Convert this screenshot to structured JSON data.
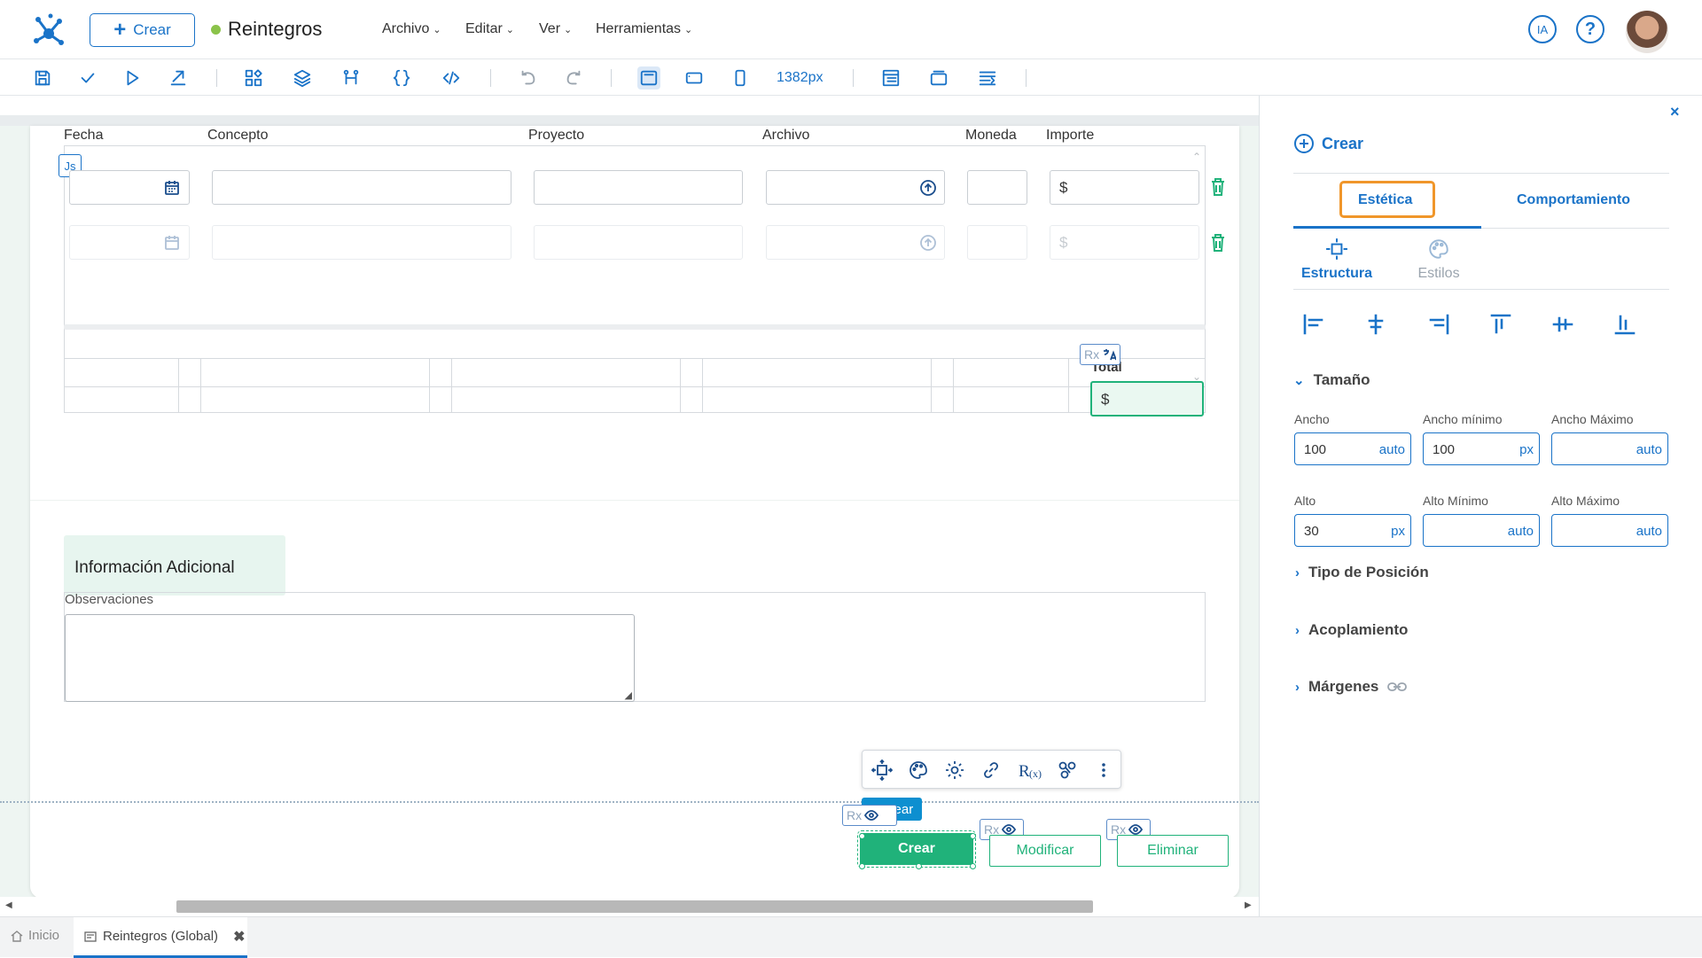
{
  "app": {
    "new_label": "Crear",
    "doc_title": "Reintegros"
  },
  "menu": [
    {
      "label": "Archivo"
    },
    {
      "label": "Editar"
    },
    {
      "label": "Ver"
    },
    {
      "label": "Herramientas"
    }
  ],
  "header": {
    "ia_label": "IA",
    "help_label": "?"
  },
  "toolbar": {
    "zoom": "1382px"
  },
  "grid": {
    "columns": [
      "Fecha",
      "Concepto",
      "Proyecto",
      "Archivo",
      "Moneda",
      "Importe"
    ],
    "currency_symbol": "$"
  },
  "totals": {
    "label": "Total",
    "currency_symbol": "$"
  },
  "section": {
    "title": "Información Adicional",
    "observations_label": "Observaciones"
  },
  "badges": {
    "js": "Js",
    "rx": "Rx"
  },
  "buttons": {
    "crear": "Crear",
    "modificar": "Modificar",
    "eliminar": "Eliminar",
    "crear_tag": "Crear"
  },
  "panel": {
    "new_label": "Crear",
    "tabs": [
      "Estética",
      "Comportamiento"
    ],
    "subtabs": [
      "Estructura",
      "Estilos"
    ],
    "size_section": "Tamaño",
    "fields": {
      "ancho": {
        "label": "Ancho",
        "value": "100",
        "unit": "auto"
      },
      "ancho_min": {
        "label": "Ancho mínimo",
        "value": "100",
        "unit": "px"
      },
      "ancho_max": {
        "label": "Ancho Máximo",
        "value": "",
        "unit": "auto"
      },
      "alto": {
        "label": "Alto",
        "value": "30",
        "unit": "px"
      },
      "alto_min": {
        "label": "Alto Mínimo",
        "value": "",
        "unit": "auto"
      },
      "alto_max": {
        "label": "Alto Máximo",
        "value": "",
        "unit": "auto"
      }
    },
    "sections": [
      "Tipo de Posición",
      "Acoplamiento",
      "Márgenes"
    ]
  },
  "tabs": {
    "home": "Inicio",
    "doc": "Reintegros (Global)"
  },
  "colors": {
    "accent": "#1a73c8",
    "green": "#20b27a",
    "orange": "#f0962a"
  }
}
